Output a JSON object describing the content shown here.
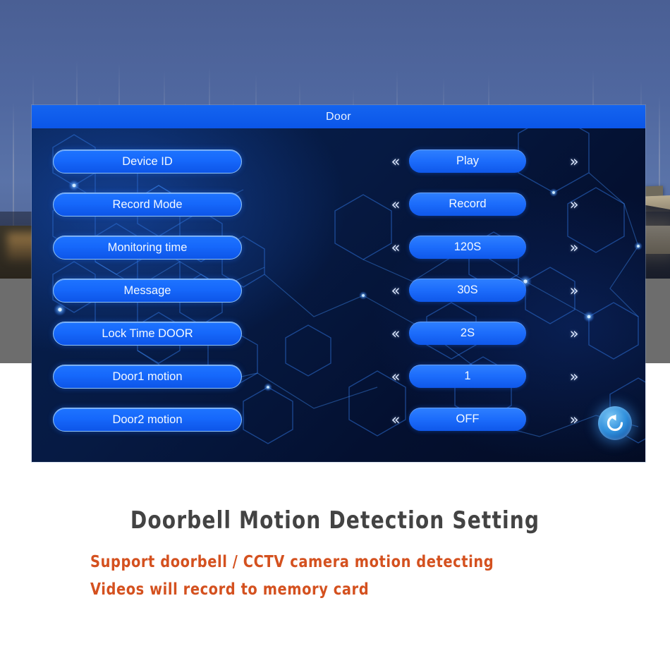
{
  "scene": {
    "description": "Modern house at dusk with bare trees",
    "photo_overlay_color": "#5068a0",
    "ground_strip_color": "#6d6d6d"
  },
  "panel": {
    "title": "Door",
    "title_bar_color": "#0f5bed",
    "background_color": "#061a43",
    "accent_color": "#1e74ff",
    "border_color": "#8fc2f5",
    "prev_icon": "«",
    "next_icon": "»",
    "prev_icon_name": "double-chevron-left-icon",
    "next_icon_name": "double-chevron-right-icon",
    "return_button": {
      "icon": "return-arrow-icon",
      "label": "Return"
    },
    "rows": [
      {
        "label": "Device ID",
        "value": "Play"
      },
      {
        "label": "Record Mode",
        "value": "Record"
      },
      {
        "label": "Monitoring time",
        "value": "120S"
      },
      {
        "label": "Message",
        "value": "30S"
      },
      {
        "label": "Lock Time DOOR",
        "value": "2S"
      },
      {
        "label": "Door1 motion",
        "value": "1"
      },
      {
        "label": "Door2 motion",
        "value": "OFF"
      }
    ]
  },
  "captions": {
    "heading": "Doorbell  Motion  Detection  Setting",
    "heading_color": "#434343",
    "line1": "Support  doorbell / CCTV  camera  motion  detecting",
    "line2": "Videos  will  record  to  memory  card",
    "subtitle_color": "#d4511f"
  }
}
